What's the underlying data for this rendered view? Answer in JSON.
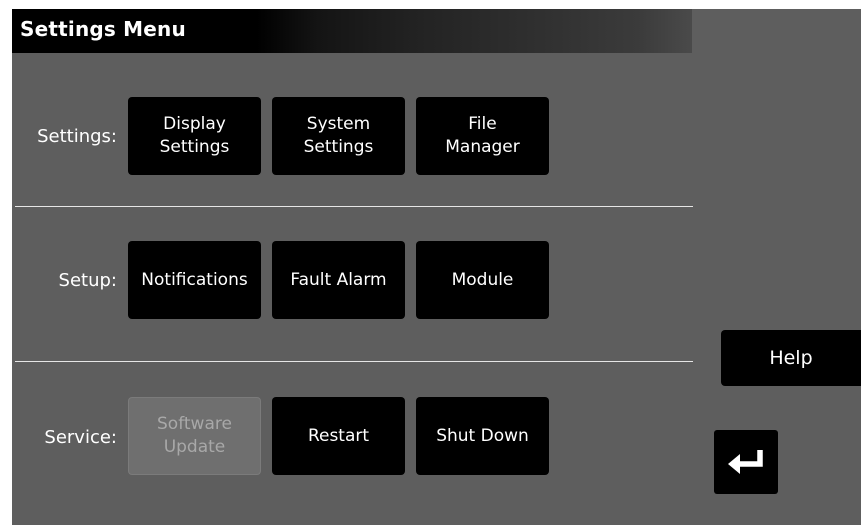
{
  "header": {
    "title": "Settings Menu"
  },
  "sections": {
    "settings": {
      "label": "Settings:",
      "display_settings": "Display\nSettings",
      "system_settings": "System\nSettings",
      "file_manager": "File\nManager"
    },
    "setup": {
      "label": "Setup:",
      "notifications": "Notifications",
      "fault_alarm": "Fault Alarm",
      "module": "Module"
    },
    "service": {
      "label": "Service:",
      "software_update": "Software\nUpdate",
      "software_update_state": "disabled",
      "restart": "Restart",
      "shut_down": "Shut Down"
    }
  },
  "sidebar": {
    "help": "Help",
    "back_icon": "return-arrow-icon"
  },
  "colors": {
    "background": "#5e5e5e",
    "button": "#000000",
    "button_text": "#ffffff",
    "disabled_button": "#6f6f6f",
    "disabled_text": "#a8a8a8",
    "divider": "#e6e6e6"
  }
}
